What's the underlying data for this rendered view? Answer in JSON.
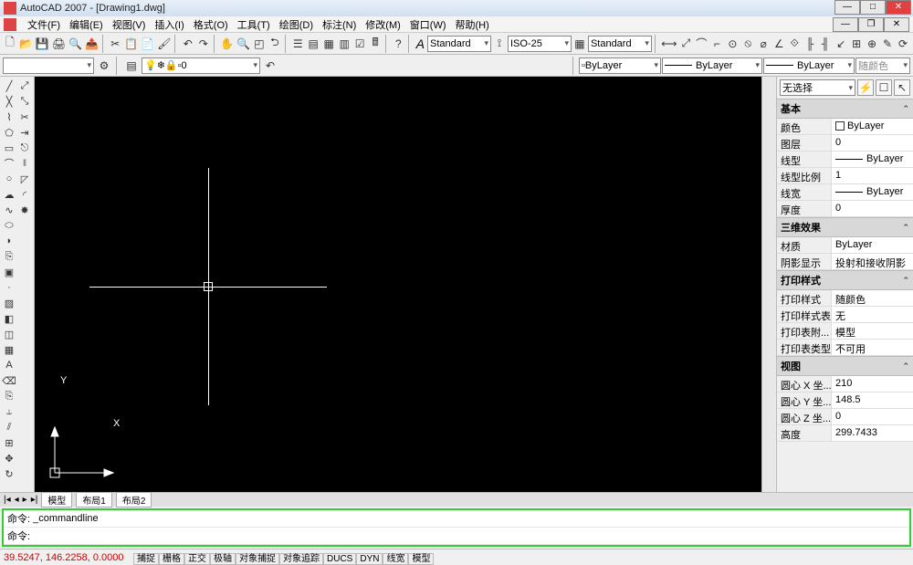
{
  "title": "AutoCAD 2007 - [Drawing1.dwg]",
  "menus": [
    "文件(F)",
    "编辑(E)",
    "视图(V)",
    "插入(I)",
    "格式(O)",
    "工具(T)",
    "绘图(D)",
    "标注(N)",
    "修改(M)",
    "窗口(W)",
    "帮助(H)"
  ],
  "toolbar1": {
    "text_style": "Standard",
    "dim_style": "ISO-25",
    "table_style": "Standard"
  },
  "toolbar2": {
    "layer": "0",
    "color": "ByLayer",
    "linetype": "ByLayer",
    "lineweight": "ByLayer",
    "plot_style": "随颜色"
  },
  "properties": {
    "selector": "无选择",
    "sections": {
      "basic": {
        "title": "基本",
        "rows": [
          {
            "lbl": "颜色",
            "val": "ByLayer",
            "swatch": true
          },
          {
            "lbl": "图层",
            "val": "0"
          },
          {
            "lbl": "线型",
            "val": "ByLayer",
            "line": true
          },
          {
            "lbl": "线型比例",
            "val": "1"
          },
          {
            "lbl": "线宽",
            "val": "ByLayer",
            "line": true
          },
          {
            "lbl": "厚度",
            "val": "0"
          }
        ]
      },
      "render": {
        "title": "三维效果",
        "rows": [
          {
            "lbl": "材质",
            "val": "ByLayer"
          },
          {
            "lbl": "阴影显示",
            "val": "投射和接收阴影"
          }
        ]
      },
      "plot": {
        "title": "打印样式",
        "rows": [
          {
            "lbl": "打印样式",
            "val": "随颜色"
          },
          {
            "lbl": "打印样式表",
            "val": "无"
          },
          {
            "lbl": "打印表附...",
            "val": "模型"
          },
          {
            "lbl": "打印表类型",
            "val": "不可用"
          }
        ]
      },
      "view": {
        "title": "视图",
        "rows": [
          {
            "lbl": "圆心 X 坐...",
            "val": "210"
          },
          {
            "lbl": "圆心 Y 坐...",
            "val": "148.5"
          },
          {
            "lbl": "圆心 Z 坐...",
            "val": "0"
          },
          {
            "lbl": "高度",
            "val": "299.7433"
          }
        ]
      }
    }
  },
  "command": {
    "prompt": "命令:",
    "history": "_commandline"
  },
  "status": {
    "coords": "39.5247, 146.2258, 0.0000",
    "toggles": [
      "捕捉",
      "栅格",
      "正交",
      "极轴",
      "对象捕捉",
      "对象追踪",
      "DUCS",
      "DYN",
      "线宽",
      "模型"
    ]
  },
  "tabs": {
    "model": "模型",
    "layout1": "布局1",
    "layout2": "布局2"
  },
  "ucs": {
    "x": "X",
    "y": "Y"
  }
}
